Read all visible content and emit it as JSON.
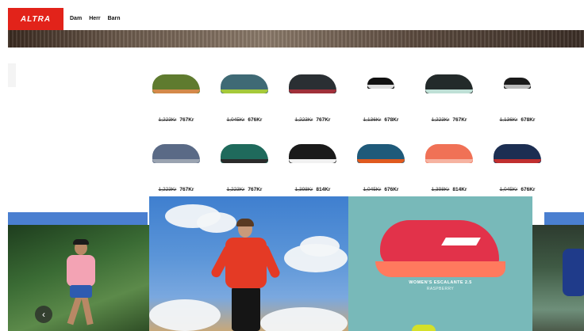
{
  "brand": {
    "logo_text": "ALTRA",
    "accent": "#e2231a"
  },
  "nav": {
    "items": [
      "Dam",
      "Herr",
      "Barn"
    ]
  },
  "products": [
    {
      "color": "#5f7b2f",
      "sole": "#d4894a",
      "old_price": "1,223Kr",
      "price": "767Kr"
    },
    {
      "color": "#3f6a75",
      "sole": "#a5c93a",
      "old_price": "1,045Kr",
      "price": "676Kr"
    },
    {
      "color": "#2a2f33",
      "sole": "#a0303a",
      "old_price": "1,223Kr",
      "price": "767Kr"
    },
    {
      "color": "#111111",
      "sole": "#dddddd",
      "old_price": "1,136Kr",
      "price": "678Kr"
    },
    {
      "color": "#232a2a",
      "sole": "#bfe0d6",
      "old_price": "1,223Kr",
      "price": "767Kr"
    },
    {
      "color": "#1a1a1a",
      "sole": "#bbbbbb",
      "old_price": "1,136Kr",
      "price": "678Kr"
    },
    {
      "color": "#5a6a86",
      "sole": "#9aa3b0",
      "old_price": "1,223Kr",
      "price": "767Kr"
    },
    {
      "color": "#1f6a5c",
      "sole": "#2a2a2a",
      "old_price": "1,223Kr",
      "price": "767Kr"
    },
    {
      "color": "#1a1a1a",
      "sole": "#f1f1f1",
      "old_price": "1,398Kr",
      "price": "814Kr"
    },
    {
      "color": "#1f5a7a",
      "sole": "#e05a1f",
      "old_price": "1,045Kr",
      "price": "676Kr"
    },
    {
      "color": "#f07156",
      "sole": "#f6b3a1",
      "old_price": "1,398Kr",
      "price": "814Kr"
    },
    {
      "color": "#1c2e52",
      "sole": "#c02f2f",
      "old_price": "1,045Kr",
      "price": "676Kr"
    }
  ],
  "promo": {
    "shoe_name": "WOMEN'S ESCALANTE 2.5",
    "shoe_color": "RASPBERRY"
  },
  "carousel": {
    "prev_icon": "chevron-left-icon",
    "prev_glyph": "‹"
  }
}
